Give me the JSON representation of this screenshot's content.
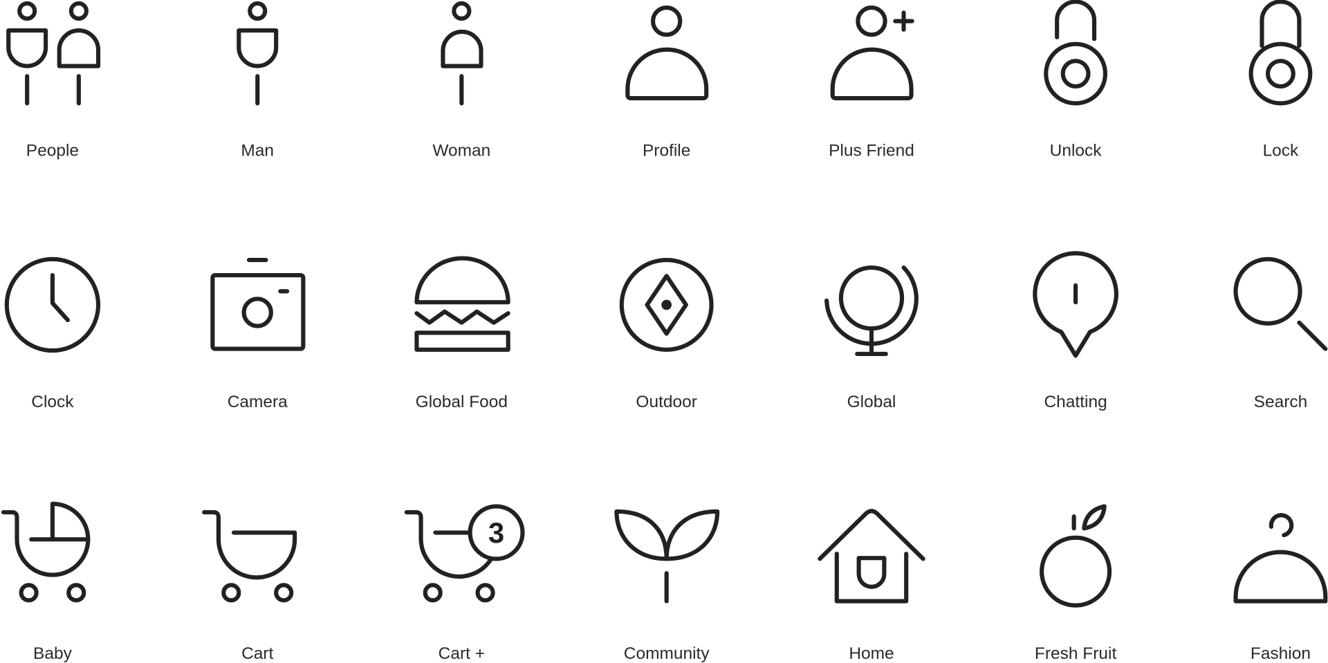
{
  "icon_color": "#222222",
  "rows": [
    [
      {
        "label": "People",
        "icon": "people-icon"
      },
      {
        "label": "Man",
        "icon": "man-icon"
      },
      {
        "label": "Woman",
        "icon": "woman-icon"
      },
      {
        "label": "Profile",
        "icon": "profile-icon"
      },
      {
        "label": "Plus Friend",
        "icon": "plus-friend-icon"
      },
      {
        "label": "Unlock",
        "icon": "unlock-icon"
      },
      {
        "label": "Lock",
        "icon": "lock-icon"
      }
    ],
    [
      {
        "label": "Clock",
        "icon": "clock-icon"
      },
      {
        "label": "Camera",
        "icon": "camera-icon"
      },
      {
        "label": "Global Food",
        "icon": "burger-icon"
      },
      {
        "label": "Outdoor",
        "icon": "compass-icon"
      },
      {
        "label": "Global",
        "icon": "globe-icon"
      },
      {
        "label": "Chatting",
        "icon": "chat-bubble-icon"
      },
      {
        "label": "Search",
        "icon": "search-icon"
      }
    ],
    [
      {
        "label": "Baby",
        "icon": "baby-stroller-icon"
      },
      {
        "label": "Cart",
        "icon": "cart-icon"
      },
      {
        "label": "Cart +",
        "icon": "cart-badge-icon",
        "badge": "3"
      },
      {
        "label": "Community",
        "icon": "sprout-icon"
      },
      {
        "label": "Home",
        "icon": "home-icon"
      },
      {
        "label": "Fresh Fruit",
        "icon": "fruit-icon"
      },
      {
        "label": "Fashion",
        "icon": "hanger-icon"
      }
    ]
  ]
}
